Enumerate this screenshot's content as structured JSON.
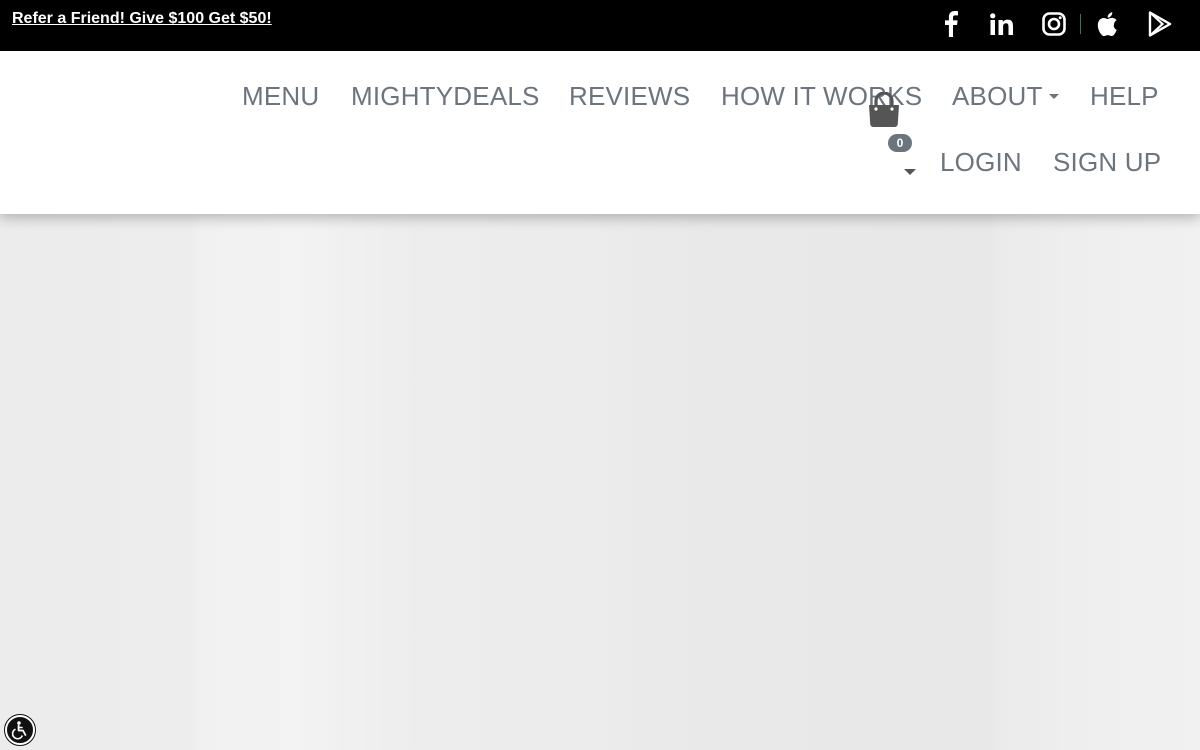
{
  "topbar": {
    "refer_text": "Refer a Friend! Give $100 Get $50!",
    "social_icons": [
      "facebook-icon",
      "linkedin-icon",
      "instagram-icon",
      "apple-icon",
      "google-play-icon"
    ]
  },
  "nav": {
    "items": [
      {
        "label": "MENU"
      },
      {
        "label": "MIGHTYDEALS"
      },
      {
        "label": "REVIEWS"
      },
      {
        "label": "HOW IT WORKS"
      },
      {
        "label": "ABOUT"
      },
      {
        "label": "HELP"
      }
    ],
    "cart_count": "0",
    "login_label": "LOGIN",
    "signup_label": "SIGN UP"
  },
  "colors": {
    "topbar_bg": "#000000",
    "nav_text": "#6c757d",
    "badge_bg": "#6c757d",
    "hero_bg": "#ececec"
  },
  "accessibility_button_icon": "accessibility-icon"
}
